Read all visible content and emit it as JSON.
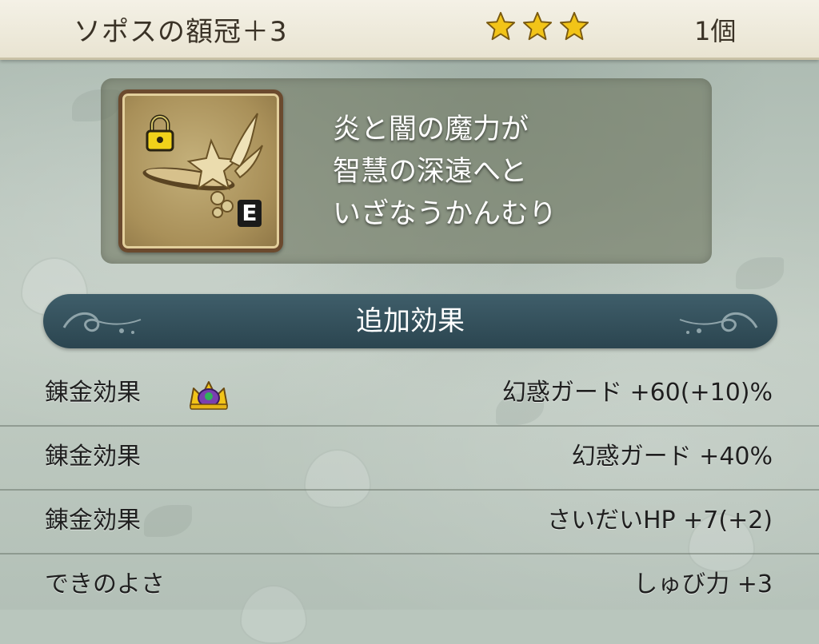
{
  "header": {
    "item_name": "ソポスの額冠＋3",
    "rarity_stars": 3,
    "count": "1個"
  },
  "item": {
    "icon": "winged-circlet-icon",
    "lock_icon": "lock-icon",
    "equipped_badge": "E",
    "description_lines": [
      "炎と闇の魔力が",
      "智慧の深遠へと",
      "いざなうかんむり"
    ]
  },
  "section": {
    "title": "追加効果"
  },
  "effects": [
    {
      "label": "錬金効果",
      "value": "幻惑ガード +60(+10)%",
      "icon": "crown-gem-icon"
    },
    {
      "label": "錬金効果",
      "value": "幻惑ガード +40%"
    },
    {
      "label": "錬金効果",
      "value": "さいだいHP +7(+2)"
    },
    {
      "label": "できのよさ",
      "value": "しゅび力 +3"
    }
  ],
  "colors": {
    "header_bg": "#f4f1e6",
    "star": "#f2c418",
    "banner": "#34505b",
    "panel": "#6e7660"
  }
}
